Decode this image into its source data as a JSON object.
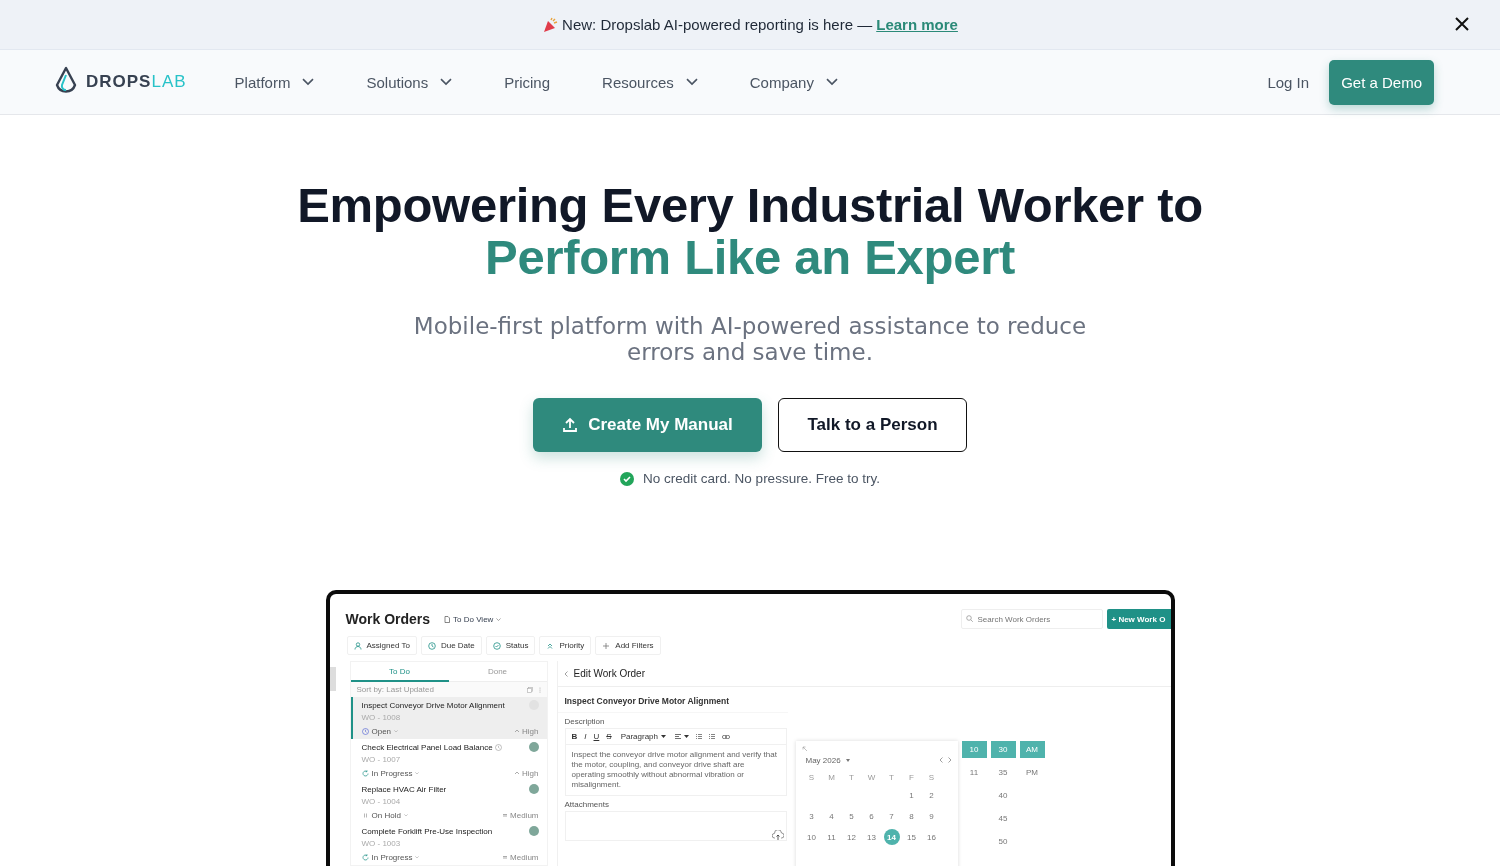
{
  "banner": {
    "text": "New: Dropslab AI-powered reporting is here —",
    "link": "Learn more"
  },
  "nav": {
    "logo": {
      "part_1": "DROPS",
      "part_2": "LAB"
    },
    "items": [
      {
        "label": "Platform",
        "has_menu": true
      },
      {
        "label": "Solutions",
        "has_menu": true
      },
      {
        "label": "Pricing",
        "has_menu": false
      },
      {
        "label": "Resources",
        "has_menu": true
      },
      {
        "label": "Company",
        "has_menu": true
      }
    ],
    "login": "Log In",
    "cta": "Get a Demo"
  },
  "hero": {
    "title_line_1": "Empowering Every Industrial Worker to",
    "title_line_2": "Perform Like an Expert",
    "subtitle": "Mobile-first platform with AI-powered assistance to reduce errors and save time.",
    "primary_button": "Create My Manual",
    "secondary_button": "Talk to a Person",
    "note": "No credit card. No pressure. Free to try."
  },
  "app": {
    "title": "Work Orders",
    "view": "To Do View",
    "search": {
      "placeholder": "Search Work Orders"
    },
    "new_button": "+ New Work O",
    "filters": [
      {
        "label": "Assigned To",
        "kind": "person"
      },
      {
        "label": "Due Date",
        "kind": "clock"
      },
      {
        "label": "Status",
        "kind": "status"
      },
      {
        "label": "Priority",
        "kind": "priority"
      },
      {
        "label": "Add Filters",
        "kind": "add"
      }
    ],
    "tabs": [
      {
        "label": "To Do",
        "selected": true
      },
      {
        "label": "Done",
        "selected": false
      }
    ],
    "sort": "Sort by: Last Updated",
    "orders": [
      {
        "title": "Inspect Conveyor Drive Motor Alignment",
        "code": "WO - 1008",
        "status": {
          "label": "Open",
          "kind": "open"
        },
        "priority": {
          "label": "High",
          "kind": "high"
        },
        "selected": true,
        "timer": false
      },
      {
        "title": "Check Electrical Panel Load Balance",
        "code": "WO - 1007",
        "status": {
          "label": "In Progress",
          "kind": "progress"
        },
        "priority": {
          "label": "High",
          "kind": "high"
        },
        "selected": false,
        "timer": true
      },
      {
        "title": "Replace HVAC Air Filter",
        "code": "WO - 1004",
        "status": {
          "label": "On Hold",
          "kind": "hold"
        },
        "priority": {
          "label": "Medium",
          "kind": "medium"
        },
        "selected": false,
        "timer": false
      },
      {
        "title": "Complete Forklift Pre-Use Inspection",
        "code": "WO - 1003",
        "status": {
          "label": "In Progress",
          "kind": "progress"
        },
        "priority": {
          "label": "Medium",
          "kind": "medium"
        },
        "selected": false,
        "timer": false
      }
    ],
    "editor": {
      "header": "Edit Work Order",
      "name": "Inspect Conveyor Drive Motor Alignment",
      "description_label": "Description",
      "format_buttons": [
        {
          "label": "B",
          "kind": "bold"
        },
        {
          "label": "I",
          "kind": "italic"
        },
        {
          "label": "U",
          "kind": "underline"
        },
        {
          "label": "S",
          "kind": "strike"
        }
      ],
      "block_style": "Paragraph",
      "description": "Inspect the conveyor drive motor alignment and verify that the motor, coupling, and conveyor drive shaft are operating smoothly without abnormal vibration or misalignment.",
      "attachments_label": "Attachments"
    },
    "date_picker": {
      "month": "May 2026",
      "weekdays": [
        "S",
        "M",
        "T",
        "W",
        "T",
        "F",
        "S"
      ],
      "weeks": [
        [
          {
            "label": "1",
            "selected": false
          },
          {
            "label": "2",
            "selected": false
          }
        ],
        [
          {
            "label": "3",
            "selected": false
          },
          {
            "label": "4",
            "selected": false
          },
          {
            "label": "5",
            "selected": false
          },
          {
            "label": "6",
            "selected": false
          },
          {
            "label": "7",
            "selected": false
          },
          {
            "label": "8",
            "selected": false
          },
          {
            "label": "9",
            "selected": false
          }
        ],
        [
          {
            "label": "10",
            "selected": false
          },
          {
            "label": "11",
            "selected": false
          },
          {
            "label": "12",
            "selected": false
          },
          {
            "label": "13",
            "selected": false
          },
          {
            "label": "14",
            "selected": true
          },
          {
            "label": "15",
            "selected": false
          },
          {
            "label": "16",
            "selected": false
          }
        ]
      ],
      "hours": [
        {
          "label": "10",
          "selected": true
        },
        {
          "label": "11",
          "selected": false
        }
      ],
      "minutes": [
        {
          "label": "30",
          "selected": true
        },
        {
          "label": "35",
          "selected": false
        },
        {
          "label": "40",
          "selected": false
        },
        {
          "label": "45",
          "selected": false
        },
        {
          "label": "50",
          "selected": false
        }
      ],
      "periods": [
        {
          "label": "AM",
          "selected": true
        },
        {
          "label": "PM",
          "selected": false
        }
      ]
    }
  }
}
